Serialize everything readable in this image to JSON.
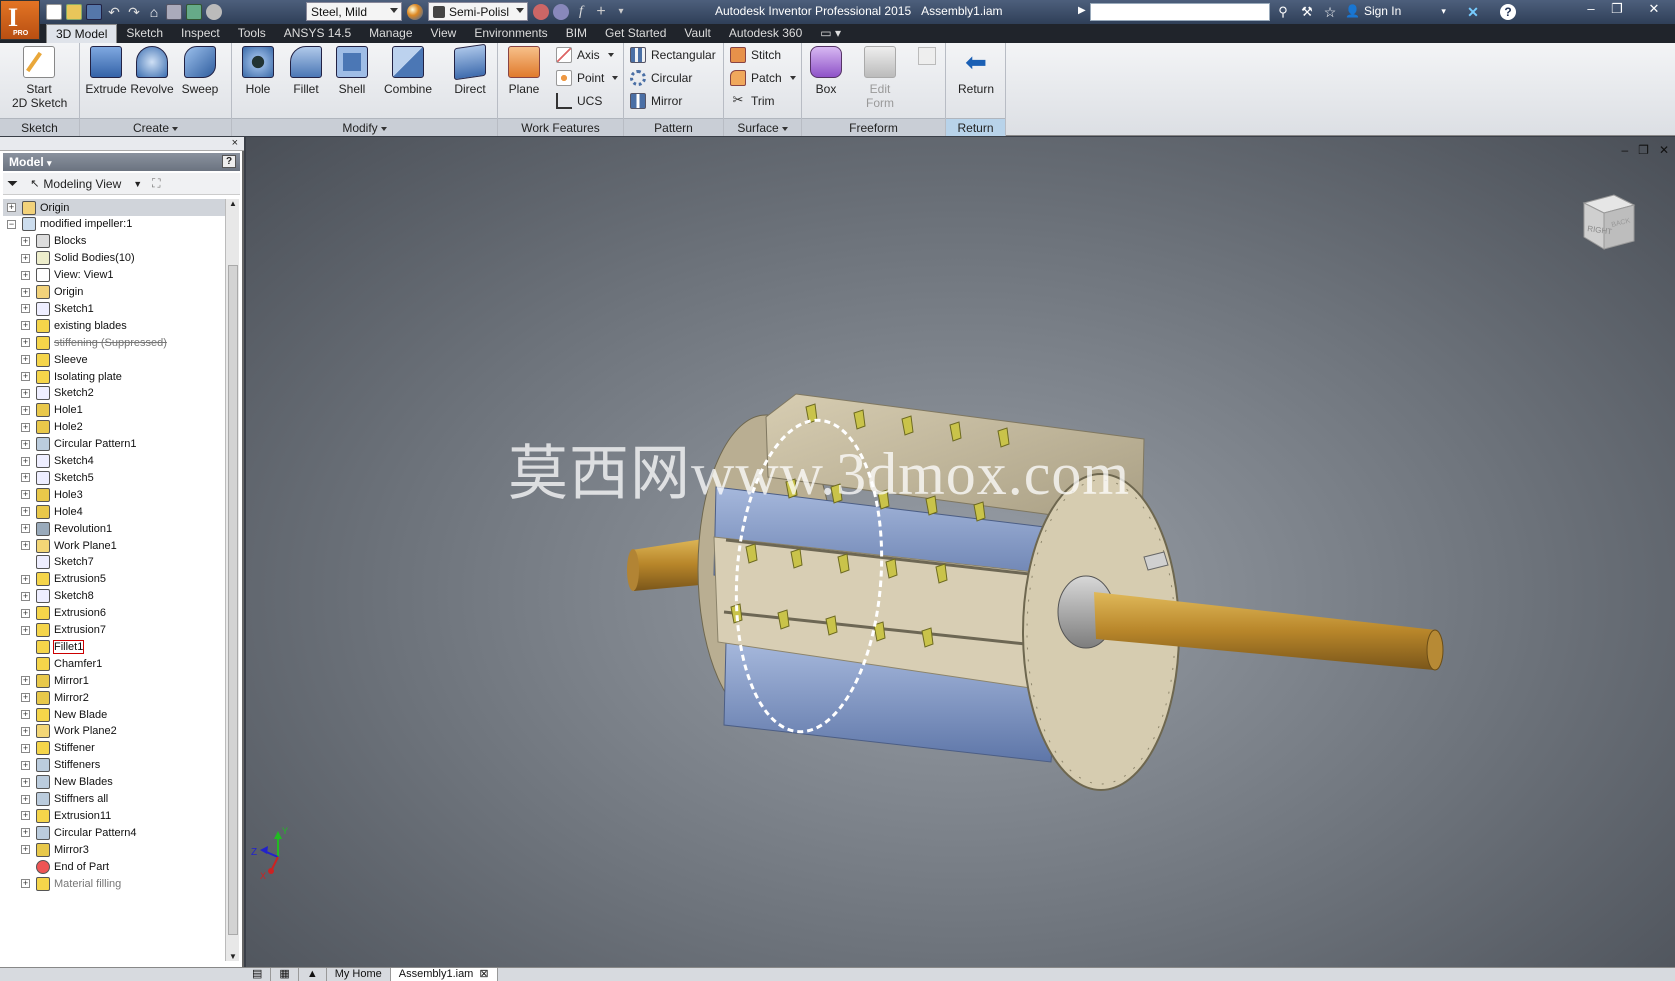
{
  "title": {
    "app_name": "Autodesk Inventor Professional 2015",
    "document": "Assembly1.iam",
    "material_select": "Steel, Mild",
    "appearance_select": "Semi-Polisl",
    "sign_in": "Sign In",
    "logo_text": "PRO",
    "help": "?"
  },
  "tabs": [
    "3D Model",
    "Sketch",
    "Inspect",
    "Tools",
    "ANSYS 14.5",
    "Manage",
    "View",
    "Environments",
    "BIM",
    "Get Started",
    "Vault",
    "Autodesk 360"
  ],
  "active_tab": "3D Model",
  "ribbon": {
    "sketch": {
      "title": "Sketch",
      "start_sketch": "Start",
      "start_sketch2": "2D Sketch"
    },
    "create": {
      "title": "Create",
      "extrude": "Extrude",
      "revolve": "Revolve",
      "sweep": "Sweep"
    },
    "modify": {
      "title": "Modify",
      "hole": "Hole",
      "fillet": "Fillet",
      "shell": "Shell",
      "combine": "Combine",
      "direct": "Direct"
    },
    "work_features": {
      "title": "Work Features",
      "plane": "Plane",
      "axis": "Axis",
      "point": "Point",
      "ucs": "UCS"
    },
    "pattern": {
      "title": "Pattern",
      "rectangular": "Rectangular",
      "circular": "Circular",
      "mirror": "Mirror"
    },
    "surface": {
      "title": "Surface",
      "stitch": "Stitch",
      "patch": "Patch",
      "trim": "Trim"
    },
    "freeform": {
      "title": "Freeform",
      "box": "Box",
      "edit_form": "Edit",
      "edit_form2": "Form"
    },
    "return": {
      "title": "Return",
      "return": "Return"
    }
  },
  "browser": {
    "header": "Model",
    "view_select": "Modeling View",
    "close": "×",
    "help": "?",
    "items": [
      {
        "label": "Origin",
        "icon": "folder-icon"
      },
      {
        "label": "modified impeller:1",
        "icon": "part-icon"
      },
      {
        "label": "Blocks",
        "icon": "blocks-icon"
      },
      {
        "label": "Solid Bodies(10)",
        "icon": "solid-bodies-icon"
      },
      {
        "label": "View: View1",
        "icon": "view-icon"
      },
      {
        "label": "Origin",
        "icon": "folder-icon"
      },
      {
        "label": "Sketch1",
        "icon": "sketch-icon"
      },
      {
        "label": "existing blades",
        "icon": "extrusion-icon"
      },
      {
        "label": "stiffening (Suppressed)",
        "icon": "extrusion-icon"
      },
      {
        "label": "Sleeve",
        "icon": "extrusion-icon"
      },
      {
        "label": "Isolating plate",
        "icon": "extrusion-icon"
      },
      {
        "label": "Sketch2",
        "icon": "sketch-icon"
      },
      {
        "label": "Hole1",
        "icon": "hole-icon"
      },
      {
        "label": "Hole2",
        "icon": "hole-icon"
      },
      {
        "label": "Circular Pattern1",
        "icon": "circular-pattern-icon"
      },
      {
        "label": "Sketch4",
        "icon": "sketch-icon"
      },
      {
        "label": "Sketch5",
        "icon": "sketch-icon"
      },
      {
        "label": "Hole3",
        "icon": "hole-icon"
      },
      {
        "label": "Hole4",
        "icon": "hole-icon"
      },
      {
        "label": "Revolution1",
        "icon": "revolve-icon"
      },
      {
        "label": "Work Plane1",
        "icon": "work-plane-icon"
      },
      {
        "label": "Sketch7",
        "icon": "sketch-icon"
      },
      {
        "label": "Extrusion5",
        "icon": "extrusion-icon"
      },
      {
        "label": "Sketch8",
        "icon": "sketch-icon"
      },
      {
        "label": "Extrusion6",
        "icon": "extrusion-icon"
      },
      {
        "label": "Extrusion7",
        "icon": "extrusion-icon"
      },
      {
        "label": "Fillet1",
        "icon": "fillet-icon"
      },
      {
        "label": "Chamfer1",
        "icon": "chamfer-icon"
      },
      {
        "label": "Mirror1",
        "icon": "mirror-icon"
      },
      {
        "label": "Mirror2",
        "icon": "mirror-icon"
      },
      {
        "label": "New Blade",
        "icon": "extrusion-icon"
      },
      {
        "label": "Work Plane2",
        "icon": "work-plane-icon"
      },
      {
        "label": "Stiffener",
        "icon": "extrusion-icon"
      },
      {
        "label": "Stiffeners",
        "icon": "circular-pattern-icon"
      },
      {
        "label": "New Blades",
        "icon": "circular-pattern-icon"
      },
      {
        "label": "Stiffners all",
        "icon": "circular-pattern-icon"
      },
      {
        "label": "Extrusion11",
        "icon": "extrusion-icon"
      },
      {
        "label": "Circular Pattern4",
        "icon": "circular-pattern-icon"
      },
      {
        "label": "Mirror3",
        "icon": "mirror-icon"
      },
      {
        "label": "End of Part",
        "icon": "end-of-part-icon"
      },
      {
        "label": "Material filling",
        "icon": "extrusion-icon"
      }
    ]
  },
  "viewport": {
    "watermark": "莫西网www.3dmox.com",
    "viewcube_face": "RIGHT",
    "viewcube_face2": "BACK",
    "axis_z": "Z",
    "axis_x": "X",
    "axis_y": "Y"
  },
  "doc_tabs": [
    "My Home",
    "Assembly1.iam"
  ],
  "doc_tab_close": "⊠",
  "colors": {
    "shaft": "#c89a3a",
    "drum": "#c9bea0",
    "blade": "#c9c34a",
    "panel_blue": "#8ea4cf",
    "title_bar": "#3a4a66"
  }
}
